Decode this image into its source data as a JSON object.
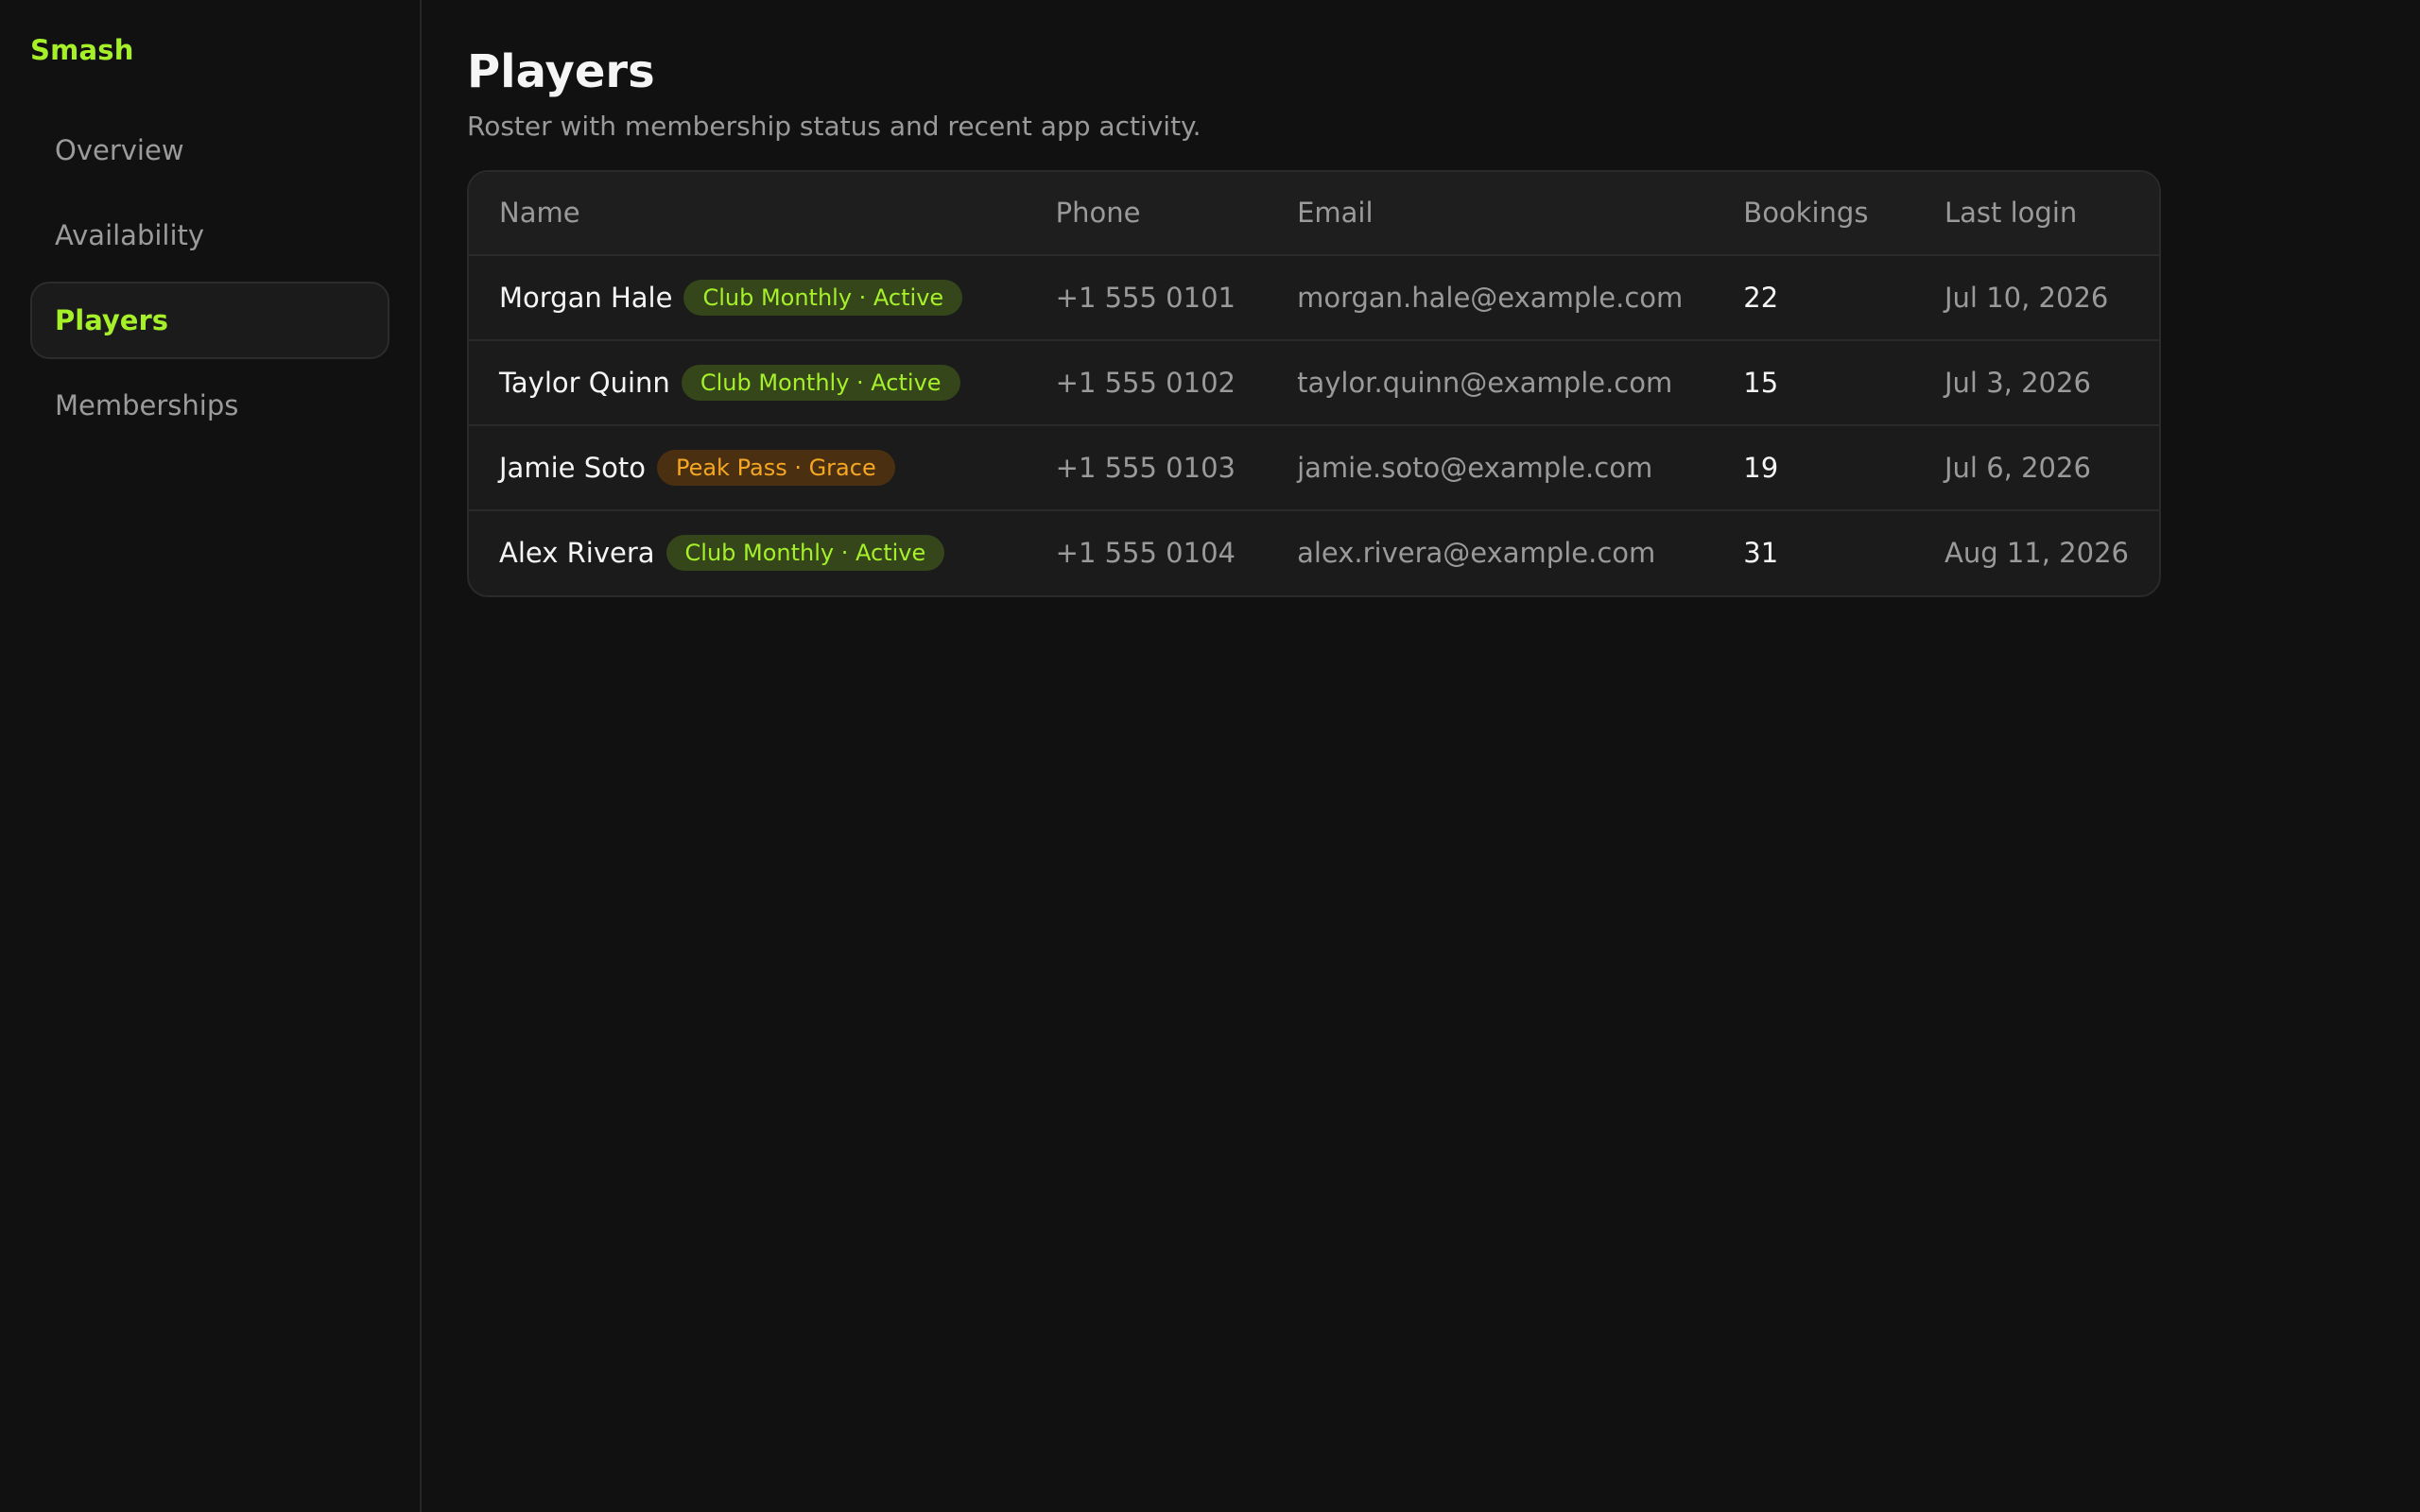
{
  "sidebar": {
    "brand": "Smash",
    "items": [
      {
        "label": "Overview",
        "active": false
      },
      {
        "label": "Availability",
        "active": false
      },
      {
        "label": "Players",
        "active": true
      },
      {
        "label": "Memberships",
        "active": false
      }
    ]
  },
  "header": {
    "title": "Players",
    "subtitle": "Roster with membership status and recent app activity."
  },
  "table": {
    "columns": [
      "Name",
      "Phone",
      "Email",
      "Bookings",
      "Last login"
    ],
    "rows": [
      {
        "name": "Morgan Hale",
        "badge": "Club Monthly · Active",
        "badge_status": "active",
        "phone": "+1 555 0101",
        "email": "morgan.hale@example.com",
        "bookings": "22",
        "last_login": "Jul 10, 2026"
      },
      {
        "name": "Taylor Quinn",
        "badge": "Club Monthly · Active",
        "badge_status": "active",
        "phone": "+1 555 0102",
        "email": "taylor.quinn@example.com",
        "bookings": "15",
        "last_login": "Jul 3, 2026"
      },
      {
        "name": "Jamie Soto",
        "badge": "Peak Pass · Grace",
        "badge_status": "grace",
        "phone": "+1 555 0103",
        "email": "jamie.soto@example.com",
        "bookings": "19",
        "last_login": "Jul 6, 2026"
      },
      {
        "name": "Alex Rivera",
        "badge": "Club Monthly · Active",
        "badge_status": "active",
        "phone": "+1 555 0104",
        "email": "alex.rivera@example.com",
        "bookings": "31",
        "last_login": "Aug 11, 2026"
      }
    ]
  },
  "colors": {
    "accent": "#a6f02a",
    "grace": "#f5a623",
    "background": "#111111",
    "card": "#1b1b1b"
  }
}
